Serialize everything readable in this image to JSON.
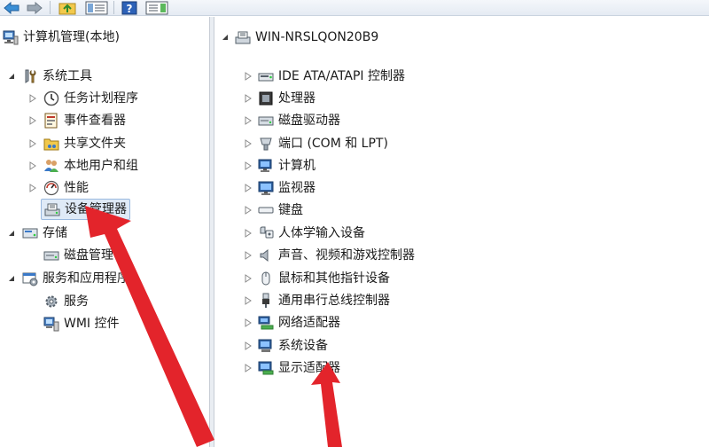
{
  "colors": {
    "accent": "#e3242b",
    "selection": "#dfeaf7",
    "tree_line": "#7a7a7a"
  },
  "toolbar": {
    "buttons": [
      {
        "icon": "back-arrow-icon"
      },
      {
        "icon": "forward-arrow-icon"
      },
      {
        "icon": "up-folder-icon"
      },
      {
        "icon": "show-hide-console-tree-icon"
      },
      {
        "icon": "help-icon"
      },
      {
        "icon": "show-action-pane-icon"
      }
    ]
  },
  "left_tree": {
    "root": {
      "label": "计算机管理(本地)",
      "icon": "computer-management-icon"
    },
    "system_tools": {
      "label": "系统工具",
      "icon": "tools-icon"
    },
    "task_scheduler": {
      "label": "任务计划程序",
      "icon": "clock-icon"
    },
    "event_viewer": {
      "label": "事件查看器",
      "icon": "event-log-icon"
    },
    "shared_folders": {
      "label": "共享文件夹",
      "icon": "shared-folder-icon"
    },
    "local_users": {
      "label": "本地用户和组",
      "icon": "users-icon"
    },
    "performance": {
      "label": "性能",
      "icon": "performance-icon"
    },
    "device_manager": {
      "label": "设备管理器",
      "icon": "device-manager-icon"
    },
    "storage": {
      "label": "存储",
      "icon": "storage-icon"
    },
    "disk_management": {
      "label": "磁盘管理",
      "icon": "disk-icon"
    },
    "services_apps": {
      "label": "服务和应用程序",
      "icon": "services-apps-icon"
    },
    "services": {
      "label": "服务",
      "icon": "gear-icon"
    },
    "wmi": {
      "label": "WMI 控件",
      "icon": "wmi-icon"
    }
  },
  "right_tree": {
    "root": {
      "label": "WIN-NRSLQON20B9",
      "icon": "computer-icon"
    },
    "devices": [
      {
        "label": "IDE ATA/ATAPI 控制器",
        "icon": "ide-controller-icon"
      },
      {
        "label": "处理器",
        "icon": "processor-icon"
      },
      {
        "label": "磁盘驱动器",
        "icon": "disk-drive-icon"
      },
      {
        "label": "端口 (COM 和 LPT)",
        "icon": "port-icon"
      },
      {
        "label": "计算机",
        "icon": "computer-icon"
      },
      {
        "label": "监视器",
        "icon": "monitor-icon"
      },
      {
        "label": "键盘",
        "icon": "keyboard-icon"
      },
      {
        "label": "人体学输入设备",
        "icon": "hid-icon"
      },
      {
        "label": "声音、视频和游戏控制器",
        "icon": "speaker-icon"
      },
      {
        "label": "鼠标和其他指针设备",
        "icon": "mouse-icon"
      },
      {
        "label": "通用串行总线控制器",
        "icon": "usb-icon"
      },
      {
        "label": "网络适配器",
        "icon": "network-adapter-icon"
      },
      {
        "label": "系统设备",
        "icon": "system-device-icon"
      },
      {
        "label": "显示适配器",
        "icon": "display-adapter-icon"
      }
    ]
  }
}
